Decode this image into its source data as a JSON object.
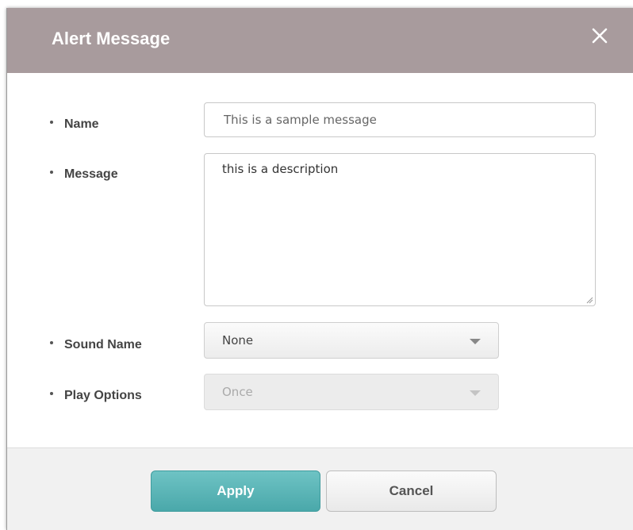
{
  "dialog": {
    "title": "Alert Message",
    "close_icon": "close-icon"
  },
  "form": {
    "name": {
      "label": "Name",
      "placeholder": "This is a sample message",
      "value": ""
    },
    "message": {
      "label": "Message",
      "value": "this is a description"
    },
    "sound_name": {
      "label": "Sound Name",
      "selected": "None",
      "icon": "chevron-down-icon"
    },
    "play_options": {
      "label": "Play Options",
      "selected": "Once",
      "disabled": true,
      "icon": "chevron-down-icon"
    }
  },
  "buttons": {
    "apply": "Apply",
    "cancel": "Cancel"
  },
  "colors": {
    "titlebar": "#a89b9d",
    "apply": "#5bb6b8"
  }
}
